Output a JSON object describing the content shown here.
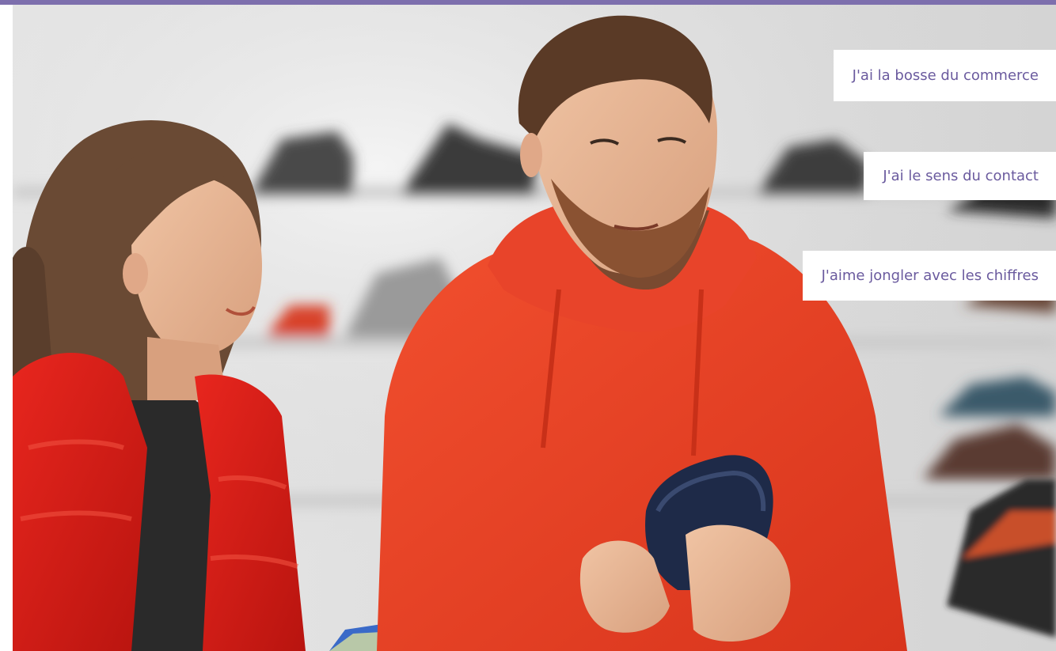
{
  "banner": {
    "accent_color": "#7d6fad",
    "text_color": "#6a5a9e",
    "photo": {
      "subject": "shop-assistants-holding-sneakers",
      "icon": "photo-icon"
    },
    "tags": [
      {
        "label": "J'ai la bosse du commerce"
      },
      {
        "label": "J'ai le sens du contact"
      },
      {
        "label": "J'aime jongler avec les chiffres"
      }
    ]
  }
}
